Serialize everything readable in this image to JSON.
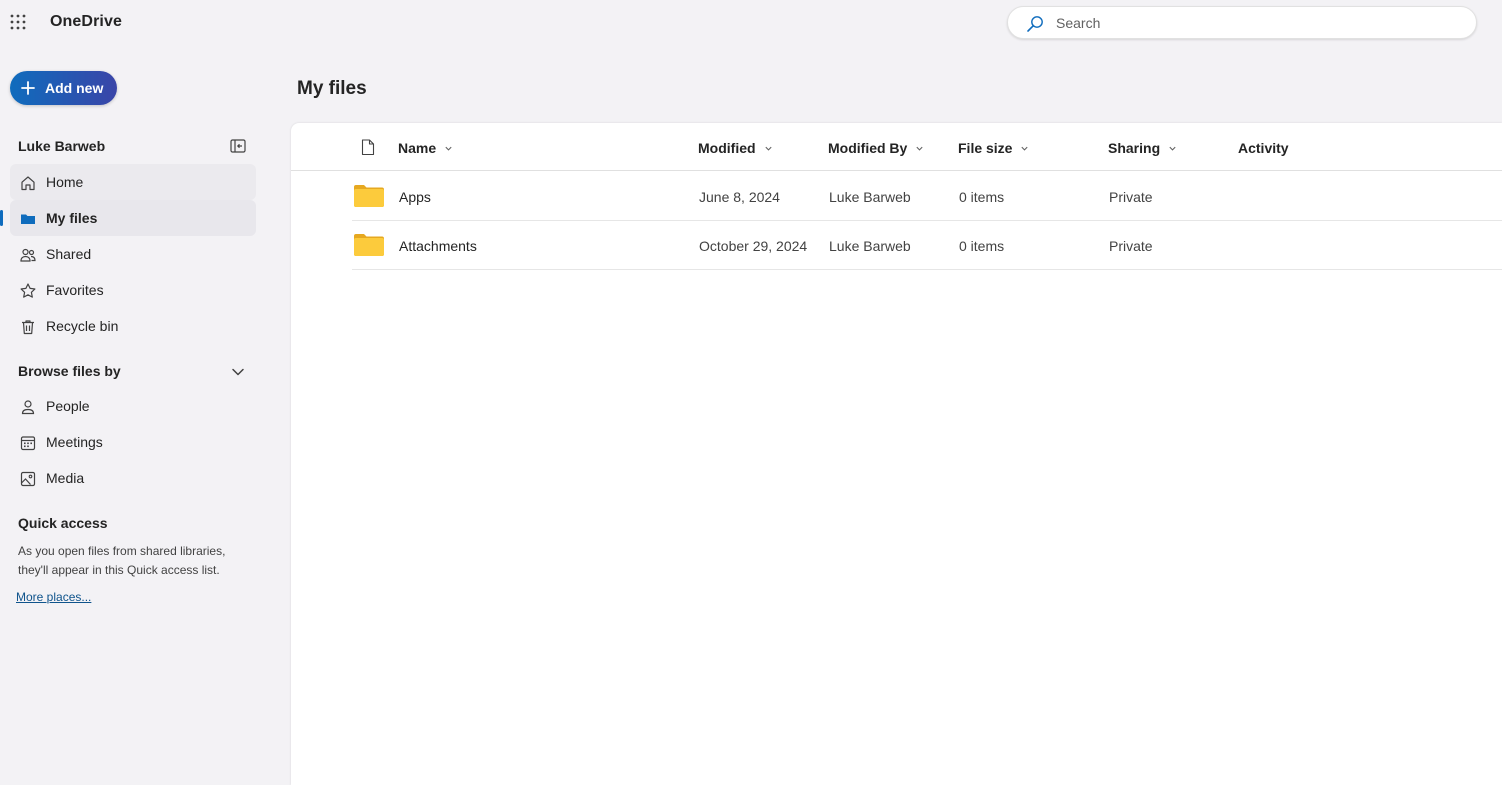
{
  "app": {
    "title": "OneDrive"
  },
  "search": {
    "placeholder": "Search"
  },
  "sidebar": {
    "add_new_label": "Add new",
    "account_name": "Luke Barweb",
    "nav_items": [
      {
        "label": "Home",
        "icon": "home-icon"
      },
      {
        "label": "My files",
        "icon": "folder-icon",
        "selected": true
      },
      {
        "label": "Shared",
        "icon": "people-icon"
      },
      {
        "label": "Favorites",
        "icon": "star-icon"
      },
      {
        "label": "Recycle bin",
        "icon": "trash-icon"
      }
    ],
    "browse_header": "Browse files by",
    "browse_items": [
      {
        "label": "People",
        "icon": "person-icon"
      },
      {
        "label": "Meetings",
        "icon": "calendar-icon"
      },
      {
        "label": "Media",
        "icon": "image-icon"
      }
    ],
    "quick_access": {
      "header": "Quick access",
      "description": "As you open files from shared libraries, they'll appear in this Quick access list.",
      "more_link": "More places..."
    }
  },
  "main": {
    "title": "My files",
    "columns": [
      "Name",
      "Modified",
      "Modified By",
      "File size",
      "Sharing",
      "Activity"
    ],
    "rows": [
      {
        "name": "Apps",
        "modified": "June 8, 2024",
        "modified_by": "Luke Barweb",
        "size": "0 items",
        "sharing": "Private",
        "activity": ""
      },
      {
        "name": "Attachments",
        "modified": "October 29, 2024",
        "modified_by": "Luke Barweb",
        "size": "0 items",
        "sharing": "Private",
        "activity": ""
      }
    ]
  },
  "colors": {
    "accent": "#0f6cbd",
    "accent_end": "#3a45a8",
    "folder": "#f8c132",
    "background": "#f3f2f5"
  }
}
